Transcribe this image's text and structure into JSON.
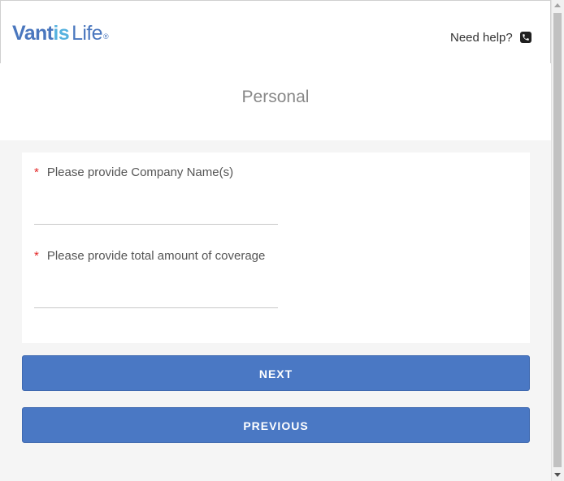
{
  "header": {
    "logo": {
      "part1": "Vant",
      "part2": "is",
      "part3": "Life",
      "registered": "®"
    },
    "help_label": "Need help?",
    "help_icon": "phone-icon"
  },
  "page": {
    "title": "Personal"
  },
  "form": {
    "fields": [
      {
        "required_marker": "*",
        "label": "Please provide Company Name(s)",
        "value": "",
        "placeholder": ""
      },
      {
        "required_marker": "*",
        "label": "Please provide total amount of coverage",
        "value": "",
        "placeholder": ""
      }
    ]
  },
  "buttons": {
    "next": "NEXT",
    "previous": "PREVIOUS"
  },
  "colors": {
    "brand_blue": "#4a77be",
    "brand_light_blue": "#56b2df",
    "button_blue": "#4a78c4",
    "required_red": "#e32626",
    "page_background": "#f5f5f5"
  }
}
